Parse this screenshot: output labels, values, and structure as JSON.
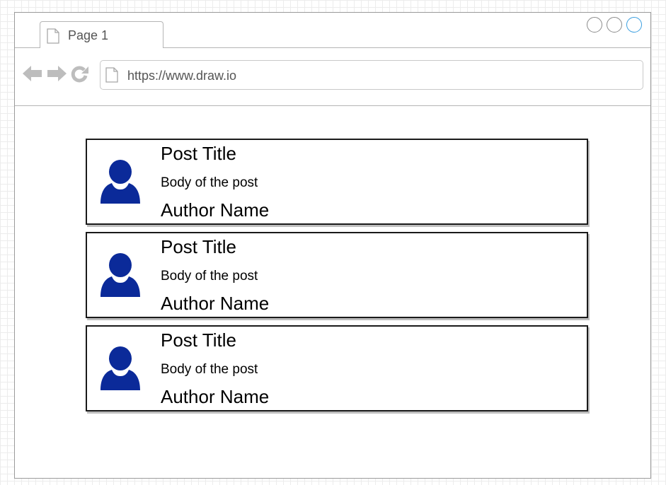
{
  "browser": {
    "tab": {
      "label": "Page 1"
    },
    "address_bar": {
      "url": "https://www.draw.io"
    },
    "window_controls": [
      "minimize",
      "restore",
      "maximize"
    ],
    "nav_icons": [
      "back-arrow-icon",
      "forward-arrow-icon",
      "refresh-icon"
    ]
  },
  "colors": {
    "avatar": "#0b2a99",
    "nav_icon": "#bdbdbd",
    "card_border": "#1a1a1a",
    "maximize_accent": "#3b9fe0"
  },
  "posts": [
    {
      "title": "Post Title",
      "body": "Body of the post",
      "author": "Author Name",
      "avatar_icon": "user-icon"
    },
    {
      "title": "Post Title",
      "body": "Body of the post",
      "author": "Author Name",
      "avatar_icon": "user-icon"
    },
    {
      "title": "Post Title",
      "body": "Body of the post",
      "author": "Author Name",
      "avatar_icon": "user-icon"
    }
  ]
}
